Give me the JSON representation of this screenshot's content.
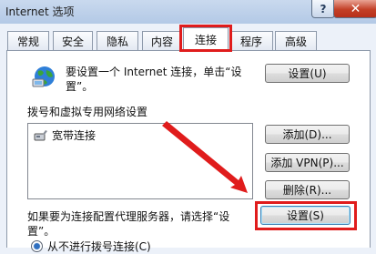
{
  "window": {
    "title": "Internet 选项",
    "help_label": "?",
    "close_label": "✕"
  },
  "tabs": [
    {
      "label": "常规",
      "active": false
    },
    {
      "label": "安全",
      "active": false
    },
    {
      "label": "隐私",
      "active": false
    },
    {
      "label": "内容",
      "active": false
    },
    {
      "label": "连接",
      "active": true
    },
    {
      "label": "程序",
      "active": false
    },
    {
      "label": "高级",
      "active": false
    }
  ],
  "intro": {
    "text": "要设置一个 Internet 连接，单击“设置”。",
    "button_label": "设置(U)",
    "icon": "globe-network-icon"
  },
  "dialup": {
    "section_label": "拨号和虚拟专用网络设置",
    "items": [
      {
        "label": "宽带连接",
        "icon": "broadband-connection-icon"
      }
    ],
    "add_label": "添加(D)...",
    "add_vpn_label": "添加 VPN(P)...",
    "delete_label": "删除(R)..."
  },
  "proxy": {
    "text": "如果要为连接配置代理服务器，请选择“设置”。",
    "button_label": "设置(S)"
  },
  "radio": {
    "label": "从不进行拨号连接(C)",
    "selected": true
  },
  "annotations": {
    "highlight_color": "#e01c1c"
  }
}
